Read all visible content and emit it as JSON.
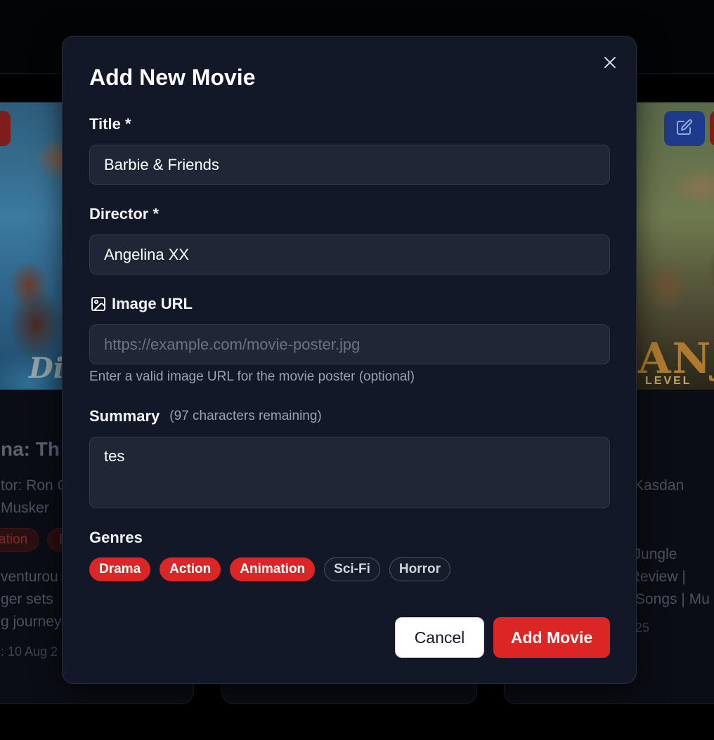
{
  "background": {
    "left_card": {
      "title": "na: Th",
      "director_line": "tor: Ron C",
      "director_line2": "Musker",
      "genres": [
        "ation",
        "D"
      ],
      "summary_lines": [
        "venturou",
        "ger sets",
        "g journey"
      ],
      "date": ": 10 Aug 2"
    },
    "right_card": {
      "director_line": "Kasdan",
      "summary_lines": [
        "e Jungle",
        ": Review |",
        "Songs | Mu"
      ],
      "date": "25",
      "poster_text": "ANJ",
      "poster_subtext": "LEVEL"
    }
  },
  "modal": {
    "title": "Add New Movie",
    "fields": {
      "title": {
        "label": "Title *",
        "value": "Barbie & Friends"
      },
      "director": {
        "label": "Director *",
        "value": "Angelina XX"
      },
      "image_url": {
        "label": "Image URL",
        "placeholder": "https://example.com/movie-poster.jpg",
        "help": "Enter a valid image URL for the movie poster (optional)"
      },
      "summary": {
        "label": "Summary",
        "counter": "(97 characters remaining)",
        "value": "tes"
      }
    },
    "genres": {
      "label": "Genres",
      "items": [
        {
          "label": "Drama",
          "selected": true
        },
        {
          "label": "Action",
          "selected": true
        },
        {
          "label": "Animation",
          "selected": true
        },
        {
          "label": "Sci-Fi",
          "selected": false
        },
        {
          "label": "Horror",
          "selected": false
        }
      ]
    },
    "buttons": {
      "cancel": "Cancel",
      "submit": "Add Movie"
    }
  },
  "colors": {
    "accent": "#dc2626",
    "modal_bg": "#121827",
    "input_bg": "#1f2736",
    "edit_button": "#1e3a8a"
  },
  "icons": {
    "close": "close-icon",
    "image": "image-icon",
    "edit": "edit-icon"
  }
}
